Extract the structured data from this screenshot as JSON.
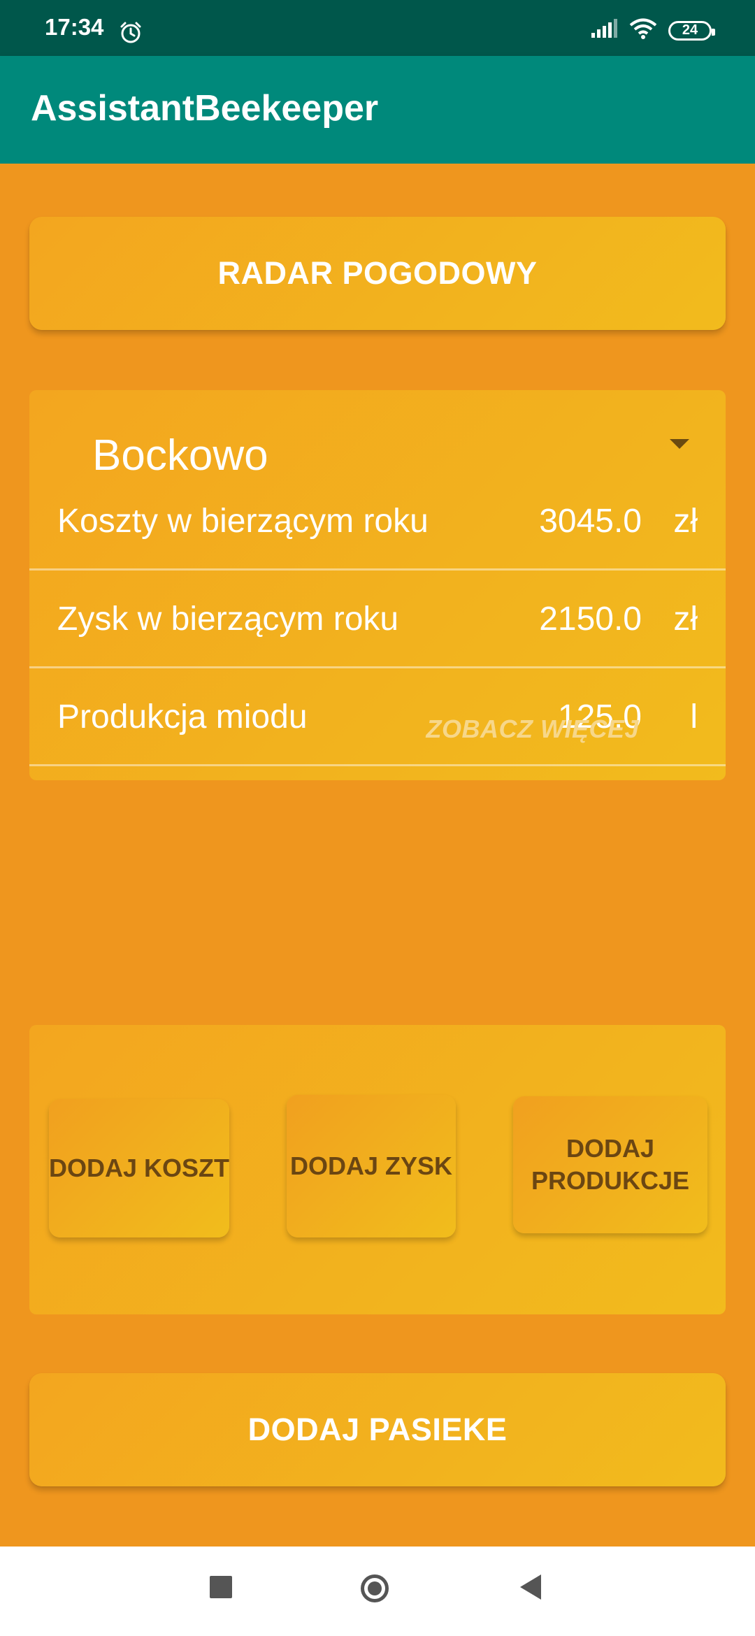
{
  "status_bar": {
    "time": "17:34",
    "alarm_icon": "alarm-clock-icon",
    "signal_icon": "cell-signal-icon",
    "wifi_icon": "wifi-icon",
    "battery_level": "24"
  },
  "app_bar": {
    "title": "AssistantBeekeeper",
    "color": "#00897b"
  },
  "weather_button": {
    "label": "RADAR POGODOWY"
  },
  "apiary_card": {
    "selected_apiary": "Bockowo",
    "stats": [
      {
        "label": "Koszty w bierzącym roku",
        "value": "3045.0",
        "unit": "zł"
      },
      {
        "label": "Zysk w bierzącym roku",
        "value": "2150.0",
        "unit": "zł"
      },
      {
        "label": "Produkcja miodu",
        "value": "125.0",
        "unit": "l"
      }
    ],
    "see_more": "ZOBACZ WIĘCEJ"
  },
  "actions": {
    "add_cost": "DODAJ KOSZT",
    "add_profit": "DODAJ ZYSK",
    "add_production": "DODAJ\nPRODUKCJE"
  },
  "add_apiary_button": {
    "label": "DODAJ PASIEKE"
  },
  "colors": {
    "background": "#ef961e",
    "card": "#f2b31e",
    "status_bar": "#00574b"
  }
}
